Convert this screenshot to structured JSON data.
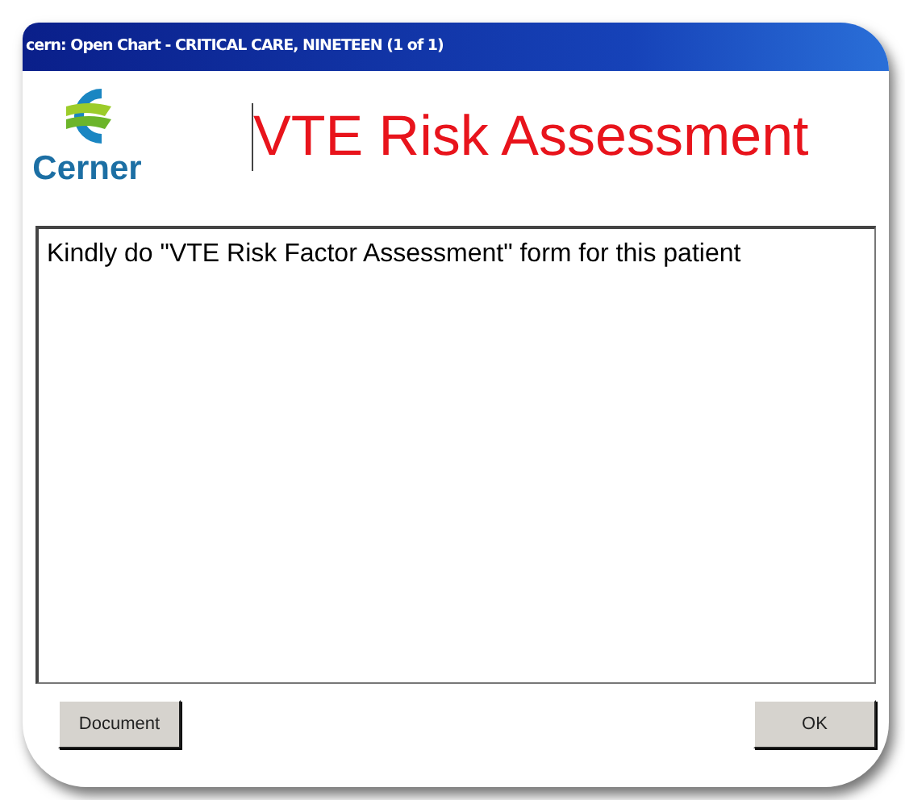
{
  "window": {
    "title": "cern: Open Chart - CRITICAL CARE, NINETEEN (1 of 1)"
  },
  "logo": {
    "text": "Cerner"
  },
  "heading": "VTE Risk Assessment",
  "message": "Kindly do \"VTE Risk Factor Assessment\" form for this patient",
  "buttons": [
    "Document",
    "OK"
  ]
}
